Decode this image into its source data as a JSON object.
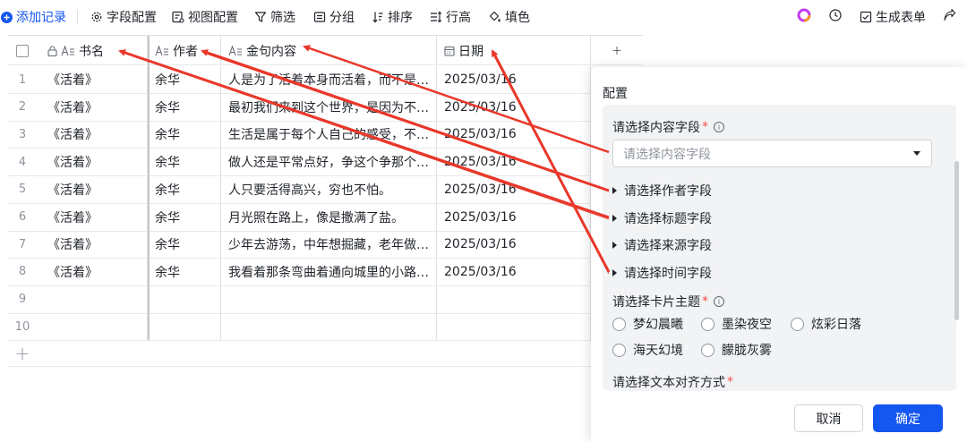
{
  "toolbar": {
    "add_record": "添加记录",
    "field_config": "字段配置",
    "view_config": "视图配置",
    "filter": "筛选",
    "group": "分组",
    "sort": "排序",
    "row_height": "行高",
    "fill_color": "填色",
    "generate_form": "生成表单"
  },
  "table": {
    "columns": [
      {
        "label": "书名",
        "icon": "text-field-icon"
      },
      {
        "label": "作者",
        "icon": "text-field-icon"
      },
      {
        "label": "金句内容",
        "icon": "text-field-icon"
      },
      {
        "label": "日期",
        "icon": "calendar-icon"
      }
    ],
    "rows": [
      {
        "index": "1",
        "book": "《活着》",
        "author": "余华",
        "quote": "人是为了活着本身而活着，而不是…",
        "date": "2025/03/16"
      },
      {
        "index": "2",
        "book": "《活着》",
        "author": "余华",
        "quote": "最初我们来到这个世界，是因为不…",
        "date": "2025/03/16"
      },
      {
        "index": "3",
        "book": "《活着》",
        "author": "余华",
        "quote": "生活是属于每个人自己的感受，不…",
        "date": "2025/03/16"
      },
      {
        "index": "4",
        "book": "《活着》",
        "author": "余华",
        "quote": "做人还是平常点好，争这个争那个…",
        "date": "2025/03/16"
      },
      {
        "index": "5",
        "book": "《活着》",
        "author": "余华",
        "quote": "人只要活得高兴，穷也不怕。",
        "date": "2025/03/16"
      },
      {
        "index": "6",
        "book": "《活着》",
        "author": "余华",
        "quote": "月光照在路上，像是撒满了盐。",
        "date": "2025/03/16"
      },
      {
        "index": "7",
        "book": "《活着》",
        "author": "余华",
        "quote": "少年去游荡，中年想掘藏，老年做…",
        "date": "2025/03/16"
      },
      {
        "index": "8",
        "book": "《活着》",
        "author": "余华",
        "quote": "我看着那条弯曲着通向城里的小路…",
        "date": "2025/03/16"
      },
      {
        "index": "9",
        "book": "",
        "author": "",
        "quote": "",
        "date": ""
      },
      {
        "index": "10",
        "book": "",
        "author": "",
        "quote": "",
        "date": ""
      }
    ]
  },
  "panel": {
    "title": "配置",
    "content_field_label": "请选择内容字段",
    "content_field_placeholder": "请选择内容字段",
    "sections": [
      "请选择作者字段",
      "请选择标题字段",
      "请选择来源字段",
      "请选择时间字段"
    ],
    "theme_label": "请选择卡片主题",
    "themes": [
      "梦幻晨曦",
      "墨染夜空",
      "炫彩日落",
      "海天幻境",
      "朦胧灰雾"
    ],
    "align_label": "请选择文本对齐方式",
    "cancel": "取消",
    "confirm": "确定"
  },
  "colors": {
    "primary": "#1456f0",
    "required": "#f54a45",
    "annotation_arrow": "#e8382a"
  }
}
